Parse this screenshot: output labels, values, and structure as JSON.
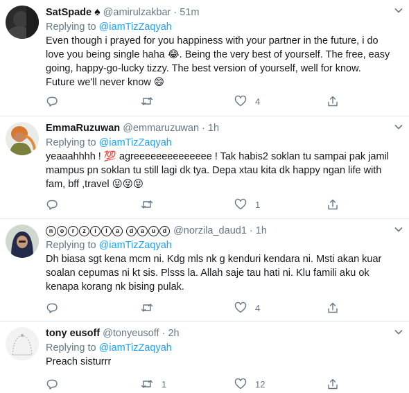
{
  "colors": {
    "link": "#1da1f2",
    "muted": "#657786",
    "text": "#14171a",
    "divider": "#e6ecf0"
  },
  "tweets": [
    {
      "name": "SatSpade",
      "name_suffix": "♠",
      "handle": "@amirulzakbar",
      "dot": "·",
      "time": "51m",
      "replying_prefix": "Replying to",
      "replying_to": "@iamTizZaqyah",
      "text_lines": [
        "Even though i prayed for you happiness with your partner in the future, i do",
        "love you being single haha 😂. Being the very best of yourself. The free, easy",
        "going, happy-go-lucky tizzy. The best version of yourself, well for know.",
        "Future we'll never know 😄"
      ],
      "replies": "",
      "retweets": "",
      "likes": "4"
    },
    {
      "name": "EmmaRuzuwan",
      "handle": "@emmaruzuwan",
      "dot": "·",
      "time": "1h",
      "replying_prefix": "Replying to",
      "replying_to": "@iamTizZaqyah",
      "text_lines": [
        "yeaaahhhh ! 💯 agreeeeeeeeeeeeee ! Tak habis2 soklan tu sampai pak jamil",
        "mampus pn soklan tu still lagi dk tya. Depa xtau kita dk happy ngan life with",
        "fam, bff ,travel 😝😝😝"
      ],
      "replies": "",
      "retweets": "",
      "likes": "1"
    },
    {
      "name_letters": [
        "n",
        "o",
        "r",
        "z",
        "i",
        "l",
        "a",
        " ",
        "d",
        "a",
        "u",
        "d"
      ],
      "name": "norzila daud",
      "handle": "@norzila_daud1",
      "dot": "·",
      "time": "1h",
      "replying_prefix": "Replying to",
      "replying_to": "@iamTizZaqyah",
      "text_lines": [
        "Dh biasa sgt kena mcm ni. Kdg mls nk g kenduri kendara ni. Msti akan kuar",
        "soalan cepumas  ni kt sis. Plsss la. Allah saje tau hati ni. Klu famili aku ok",
        "kenapa korang nk bising pulak."
      ],
      "replies": "",
      "retweets": "",
      "likes": "4"
    },
    {
      "name": "tony eusoff",
      "handle": "@tonyeusoff",
      "dot": "·",
      "time": "2h",
      "replying_prefix": "Replying to",
      "replying_to": "@iamTizZaqyah",
      "text_lines": [
        "Preach sisturrr"
      ],
      "replies": "",
      "retweets": "1",
      "likes": "12"
    }
  ]
}
